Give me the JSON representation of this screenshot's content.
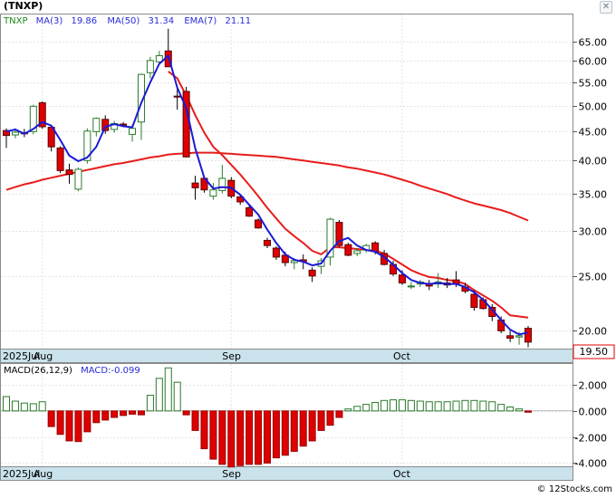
{
  "header": {
    "ticker": "(TNXP)",
    "close_glyph": "✕"
  },
  "legend": {
    "symbol": "TNXP",
    "items": [
      {
        "label": "MA(3)",
        "value": "19.86",
        "color": "#2b2bd9"
      },
      {
        "label": "MA(50)",
        "value": "31.34",
        "color": "#e02020"
      },
      {
        "label": "EMA(7)",
        "value": "21.11",
        "color": "#e02020"
      }
    ]
  },
  "colors": {
    "up": "#ffffff",
    "up_edge": "#2a7a2a",
    "down": "#e00000",
    "down_edge": "#5a0000",
    "ma_blue": "#1a1ad6",
    "ma_red": "#e81c1c",
    "axis_band": "#c9e2ec",
    "hist_pos": "#2a7a2a",
    "hist_neg": "#dd0000",
    "label_box_border": "#e00000"
  },
  "chart_data": [
    {
      "type": "candlestick",
      "yscale": "log",
      "ylim": [
        18.6,
        72.5
      ],
      "yticks": [
        "20.00",
        "25.00",
        "30.00",
        "35.00",
        "40.00",
        "45.00",
        "50.00",
        "55.00",
        "60.00",
        "65.00"
      ],
      "xlabels": [
        {
          "label": "2025Jul",
          "index": -0.4
        },
        {
          "label": "Aug",
          "index": 4
        },
        {
          "label": "Sep",
          "index": 25
        },
        {
          "label": "Oct",
          "index": 44
        }
      ],
      "last_price_label": "19.50",
      "ohlc": [
        [
          45.2,
          45.6,
          42.1,
          44.3
        ],
        [
          44.4,
          45.6,
          43.8,
          44.9
        ],
        [
          44.8,
          45.5,
          44.0,
          44.6
        ],
        [
          45.0,
          50.2,
          44.5,
          49.9
        ],
        [
          50.6,
          50.9,
          45.5,
          45.9
        ],
        [
          45.8,
          46.1,
          41.5,
          42.3
        ],
        [
          42.1,
          42.4,
          38.0,
          38.4
        ],
        [
          38.5,
          39.5,
          36.4,
          37.8
        ],
        [
          35.6,
          38.9,
          35.3,
          38.6
        ],
        [
          40.0,
          45.6,
          39.5,
          45.1
        ],
        [
          45.0,
          47.7,
          44.1,
          47.5
        ],
        [
          47.3,
          48.1,
          44.6,
          45.2
        ],
        [
          45.4,
          47.0,
          44.8,
          46.5
        ],
        [
          46.4,
          46.8,
          45.8,
          46.2
        ],
        [
          44.5,
          46.3,
          43.2,
          45.6
        ],
        [
          46.8,
          57.0,
          43.5,
          56.8
        ],
        [
          57.2,
          61.0,
          55.9,
          60.1
        ],
        [
          59.8,
          62.5,
          59.0,
          61.3
        ],
        [
          62.5,
          68.4,
          59.9,
          58.6
        ],
        [
          52.0,
          53.6,
          49.2,
          51.8
        ],
        [
          53.0,
          54.0,
          40.5,
          40.6
        ],
        [
          36.5,
          37.6,
          34.1,
          35.8
        ],
        [
          37.2,
          37.6,
          35.1,
          35.5
        ],
        [
          34.6,
          36.5,
          34.1,
          35.5
        ],
        [
          35.4,
          39.3,
          35.0,
          37.2
        ],
        [
          36.9,
          37.4,
          34.3,
          34.6
        ],
        [
          34.5,
          34.7,
          33.4,
          33.8
        ],
        [
          33.0,
          33.5,
          31.8,
          31.9
        ],
        [
          31.4,
          31.6,
          30.3,
          30.4
        ],
        [
          28.9,
          29.2,
          28.0,
          28.3
        ],
        [
          28.0,
          28.2,
          26.7,
          27.0
        ],
        [
          27.2,
          27.6,
          26.0,
          26.4
        ],
        [
          26.4,
          26.9,
          25.7,
          26.6
        ],
        [
          26.7,
          27.3,
          25.7,
          26.5
        ],
        [
          25.6,
          25.9,
          24.4,
          25.0
        ],
        [
          26.0,
          26.9,
          25.2,
          26.6
        ],
        [
          27.0,
          31.7,
          26.1,
          31.5
        ],
        [
          31.1,
          31.4,
          28.1,
          28.3
        ],
        [
          28.4,
          28.6,
          27.1,
          27.2
        ],
        [
          27.4,
          28.0,
          27.1,
          27.7
        ],
        [
          27.8,
          28.5,
          27.5,
          28.3
        ],
        [
          28.6,
          28.8,
          27.3,
          27.6
        ],
        [
          27.4,
          27.8,
          26.1,
          26.2
        ],
        [
          26.2,
          26.6,
          25.0,
          25.2
        ],
        [
          25.1,
          25.6,
          24.1,
          24.3
        ],
        [
          24.0,
          24.4,
          23.7,
          24.0
        ],
        [
          24.2,
          24.6,
          23.9,
          24.4
        ],
        [
          24.2,
          24.6,
          23.6,
          24.0
        ],
        [
          24.2,
          25.3,
          23.8,
          24.4
        ],
        [
          24.3,
          24.8,
          23.8,
          24.1
        ],
        [
          24.6,
          25.5,
          23.9,
          24.2
        ],
        [
          23.9,
          24.3,
          23.3,
          23.5
        ],
        [
          23.2,
          23.6,
          21.7,
          22.0
        ],
        [
          22.7,
          22.9,
          21.8,
          21.9
        ],
        [
          22.0,
          22.3,
          20.8,
          21.2
        ],
        [
          20.9,
          21.2,
          19.8,
          20.0
        ],
        [
          19.6,
          20.0,
          19.1,
          19.4
        ],
        [
          19.5,
          19.9,
          18.9,
          19.6
        ],
        [
          20.2,
          20.4,
          18.7,
          19.1
        ]
      ],
      "ma3": [
        45.0,
        45.4,
        44.6,
        45.5,
        46.8,
        46.1,
        43.5,
        40.8,
        39.9,
        40.5,
        42.3,
        45.9,
        46.4,
        46.0,
        45.8,
        50.6,
        55.0,
        59.3,
        61.3,
        53.8,
        49.5,
        42.0,
        37.3,
        35.7,
        35.9,
        35.8,
        34.8,
        33.4,
        32.1,
        30.2,
        28.6,
        27.3,
        26.7,
        26.5,
        26.1,
        26.3,
        27.7,
        28.8,
        29.2,
        28.3,
        27.8,
        27.6,
        27.0,
        26.2,
        25.3,
        24.6,
        24.3,
        24.2,
        24.3,
        24.2,
        24.2,
        23.9,
        23.4,
        22.7,
        21.8,
        20.9,
        20.1,
        19.7,
        19.86
      ],
      "ma50": [
        35.5,
        35.9,
        36.3,
        36.6,
        37.0,
        37.3,
        37.6,
        37.9,
        38.2,
        38.5,
        38.8,
        39.1,
        39.4,
        39.6,
        39.9,
        40.2,
        40.5,
        40.7,
        41.0,
        41.1,
        41.2,
        41.3,
        41.3,
        41.3,
        41.2,
        41.1,
        41.0,
        40.9,
        40.8,
        40.7,
        40.6,
        40.4,
        40.2,
        40.0,
        39.8,
        39.6,
        39.4,
        39.2,
        38.9,
        38.7,
        38.4,
        38.1,
        37.8,
        37.4,
        37.0,
        36.6,
        36.1,
        35.7,
        35.3,
        34.9,
        34.4,
        34.0,
        33.6,
        33.3,
        33.0,
        32.7,
        32.3,
        31.8,
        31.34
      ],
      "ema7": [
        null,
        null,
        null,
        null,
        null,
        null,
        null,
        null,
        null,
        null,
        null,
        null,
        null,
        null,
        null,
        null,
        null,
        null,
        57.5,
        55.9,
        52.1,
        48.1,
        44.8,
        42.3,
        40.9,
        39.3,
        37.8,
        36.2,
        34.6,
        33.0,
        31.6,
        30.3,
        29.4,
        28.6,
        27.7,
        27.3,
        28.1,
        28.1,
        28.0,
        27.9,
        27.8,
        27.7,
        27.4,
        26.8,
        26.2,
        25.6,
        25.2,
        24.9,
        24.8,
        24.6,
        24.5,
        24.2,
        23.6,
        23.1,
        22.6,
        22.0,
        21.3,
        21.2,
        21.11
      ]
    },
    {
      "type": "bar",
      "title": "MACD(26,12,9)",
      "label_value": "MACD:-0.099",
      "ylim": [
        -4.25,
        3.6
      ],
      "yticks": [
        "2.000",
        "0.000",
        "-2.000",
        "-4.000"
      ],
      "xlabels": [
        "2025Jul",
        "Aug",
        "Sep",
        "Oct"
      ],
      "values": [
        1.1,
        0.75,
        0.6,
        0.55,
        0.7,
        -1.2,
        -1.8,
        -2.3,
        -2.35,
        -1.6,
        -0.9,
        -0.7,
        -0.5,
        -0.35,
        -0.25,
        -0.3,
        1.2,
        2.5,
        3.3,
        2.2,
        -0.3,
        -1.5,
        -2.9,
        -3.7,
        -4.1,
        -4.3,
        -4.2,
        -4.1,
        -4.1,
        -4.0,
        -3.6,
        -3.4,
        -3.1,
        -2.7,
        -2.3,
        -1.5,
        -1.1,
        -0.5,
        0.15,
        0.35,
        0.5,
        0.65,
        0.8,
        0.85,
        0.85,
        0.8,
        0.75,
        0.7,
        0.7,
        0.7,
        0.75,
        0.8,
        0.8,
        0.75,
        0.7,
        0.5,
        0.3,
        0.15,
        -0.1
      ]
    }
  ],
  "footer": {
    "watermark": "© 12Stocks.com"
  }
}
